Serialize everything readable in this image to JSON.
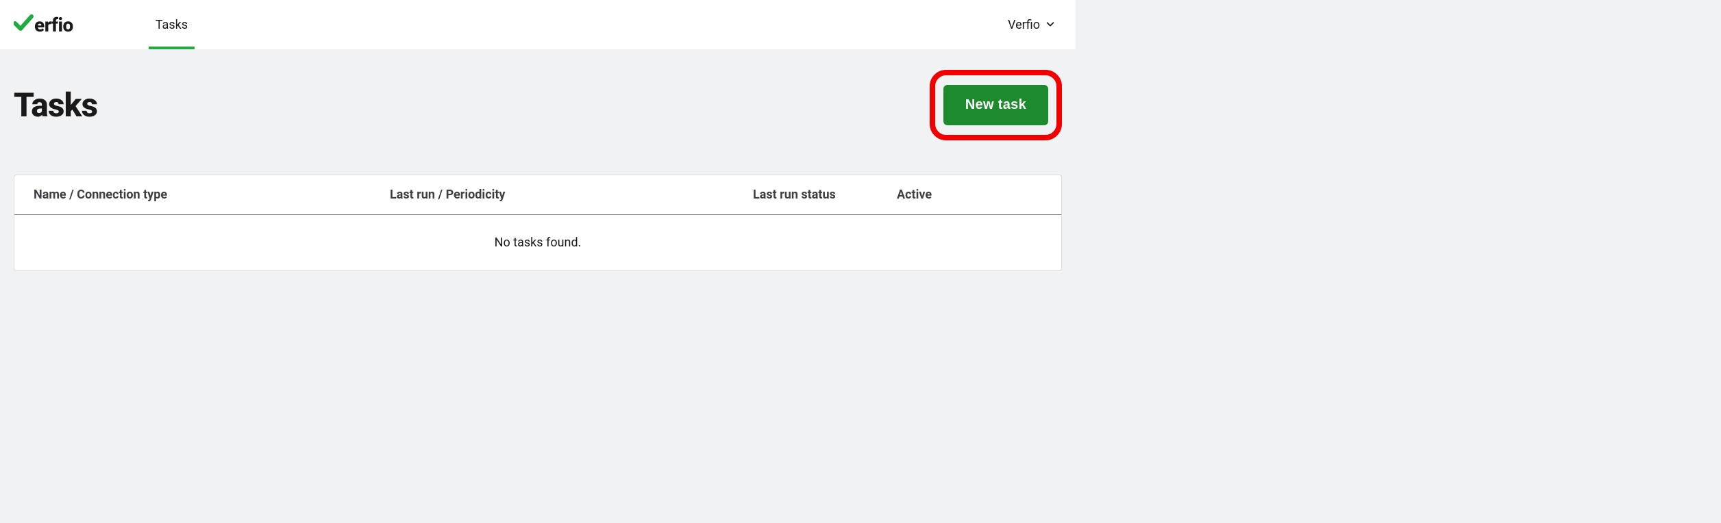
{
  "header": {
    "logo_text": "erfio",
    "nav": {
      "tasks": "Tasks"
    },
    "org_name": "Verfio"
  },
  "page": {
    "title": "Tasks",
    "new_task_button": "New task"
  },
  "table": {
    "columns": {
      "name": "Name / Connection type",
      "lastrun": "Last run / Periodicity",
      "status": "Last run status",
      "active": "Active"
    },
    "empty_message": "No tasks found."
  }
}
